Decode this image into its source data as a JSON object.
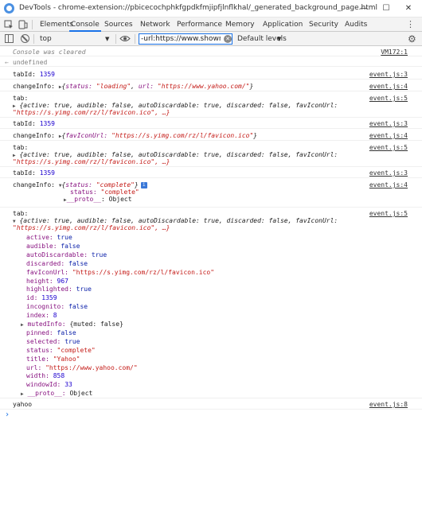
{
  "window": {
    "title": "DevTools - chrome-extension://pbicecochphkfgpdkfmjipfjlnflkhal/_generated_background_page.html",
    "min_glyph": "—",
    "max_glyph": "☐",
    "close_glyph": "✕"
  },
  "tabs": [
    "Elements",
    "Console",
    "Sources",
    "Network",
    "Performance",
    "Memory",
    "Application",
    "Security",
    "Audits"
  ],
  "tabs_more": "»",
  "tabs_kebab": "⋮",
  "toolbar": {
    "context": "top",
    "filter_value": "-url:https://www.showroom-",
    "levels": "Default levels"
  },
  "console": {
    "cleared": {
      "text": "Console was cleared",
      "src": "VM172:1"
    },
    "undefined": "undefined",
    "messages": [
      {
        "label": "tabId:",
        "value": "1359",
        "src": "event.js:3"
      },
      {
        "label": "changeInfo:",
        "preview_pre": "{",
        "k1": "status:",
        "v1": "\"loading\"",
        "sep": ", ",
        "k2": "url:",
        "v2": "\"https://www.yahoo.com/\"",
        "post": "}",
        "src": "event.js:4"
      },
      {
        "label": "tab:",
        "line1": "{active: true, audible: false, autoDiscardable: true, discarded: false, favIconUrl:",
        "line2": "\"https://s.yimg.com/rz/l/favicon.ico\", …}",
        "src": "event.js:5"
      },
      {
        "label": "tabId:",
        "value": "1359",
        "src": "event.js:3"
      },
      {
        "label": "changeInfo:",
        "k1": "favIconUrl:",
        "v1": "\"https://s.yimg.com/rz/l/favicon.ico\"",
        "src": "event.js:4"
      },
      {
        "label": "tab:",
        "line1": "{active: true, audible: false, autoDiscardable: true, discarded: false, favIconUrl:",
        "line2": "\"https://s.yimg.com/rz/l/favicon.ico\", …}",
        "src": "event.js:5"
      },
      {
        "label": "tabId:",
        "value": "1359",
        "src": "event.js:3"
      },
      {
        "label": "changeInfo:",
        "k1": "status:",
        "v1": "\"complete\"",
        "expanded_k": "status:",
        "expanded_v": "\"complete\"",
        "proto": "__proto__",
        "proto_v": "Object",
        "src": "event.js:4"
      }
    ],
    "tab_expanded": {
      "label": "tab:",
      "line1": "{active: true, audible: false, autoDiscardable: true, discarded: false, favIconUrl:",
      "line2": "\"https://s.yimg.com/rz/l/favicon.ico\", …}",
      "src": "event.js:5",
      "props": [
        {
          "k": "active:",
          "v": "true",
          "t": "kw"
        },
        {
          "k": "audible:",
          "v": "false",
          "t": "kw"
        },
        {
          "k": "autoDiscardable:",
          "v": "true",
          "t": "kw"
        },
        {
          "k": "discarded:",
          "v": "false",
          "t": "kw"
        },
        {
          "k": "favIconUrl:",
          "v": "\"https://s.yimg.com/rz/l/favicon.ico\"",
          "t": "str"
        },
        {
          "k": "height:",
          "v": "967",
          "t": "num"
        },
        {
          "k": "highlighted:",
          "v": "true",
          "t": "kw"
        },
        {
          "k": "id:",
          "v": "1359",
          "t": "num"
        },
        {
          "k": "incognito:",
          "v": "false",
          "t": "kw"
        },
        {
          "k": "index:",
          "v": "8",
          "t": "num"
        },
        {
          "k": "mutedInfo:",
          "v": "{muted: false}",
          "t": "plain",
          "expandable": true
        },
        {
          "k": "pinned:",
          "v": "false",
          "t": "kw"
        },
        {
          "k": "selected:",
          "v": "true",
          "t": "kw"
        },
        {
          "k": "status:",
          "v": "\"complete\"",
          "t": "str"
        },
        {
          "k": "title:",
          "v": "\"Yahoo\"",
          "t": "str"
        },
        {
          "k": "url:",
          "v": "\"https://www.yahoo.com/\"",
          "t": "str"
        },
        {
          "k": "width:",
          "v": "858",
          "t": "num"
        },
        {
          "k": "windowId:",
          "v": "33",
          "t": "num"
        },
        {
          "k": "__proto__:",
          "v": "Object",
          "t": "plain",
          "expandable": true
        }
      ]
    },
    "last": {
      "text": "yahoo",
      "src": "event.js:8"
    },
    "prompt": "›"
  },
  "colors": {
    "accent": "#1a73e8",
    "key": "#881280",
    "string": "#c41a16",
    "number": "#1c00cf",
    "keyword": "#0d22aa"
  }
}
